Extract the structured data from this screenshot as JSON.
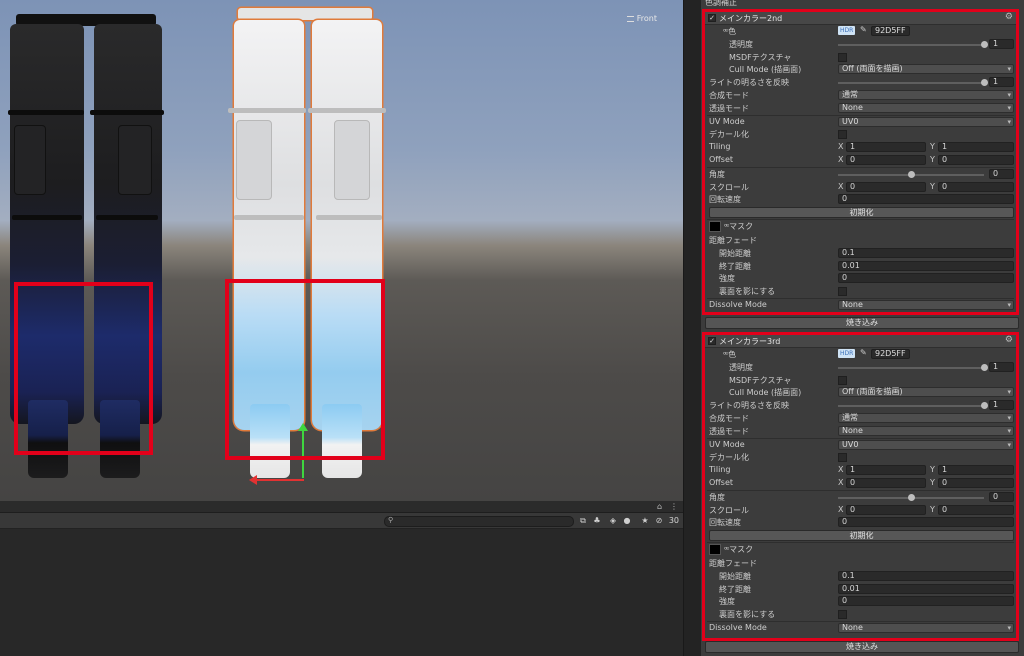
{
  "scene": {
    "view_label": "Front"
  },
  "bottom_panel": {
    "search_placeholder": "",
    "visible_count": "30"
  },
  "inspector": {
    "prev_title": "色調補正",
    "sections": [
      {
        "title": "メインカラー2nd",
        "color_label": "色",
        "hdr": "HDR",
        "hex": "92D5FF",
        "opacity_label": "透明度",
        "opacity_value": "1",
        "opacity_fraction": 1.0,
        "msdf_label": "MSDFテクスチャ",
        "cull_label": "Cull Mode (描画面)",
        "cull_value": "Off (両面を描画)",
        "light_label": "ライトの明るさを反映",
        "light_value": "1",
        "light_fraction": 1.0,
        "blend_label": "合成モード",
        "blend_value": "通常",
        "alpha_label": "透過モード",
        "alpha_value": "None",
        "uv_label": "UV Mode",
        "uv_value": "UV0",
        "decal_label": "デカール化",
        "tiling_label": "Tiling",
        "tiling_x": "1",
        "tiling_y": "1",
        "offset_label": "Offset",
        "offset_x": "0",
        "offset_y": "0",
        "angle_label": "角度",
        "angle_value": "0",
        "angle_fraction": 0.5,
        "scroll_label": "スクロール",
        "scroll_x": "0",
        "scroll_y": "0",
        "rotate_label": "回転速度",
        "rotate_value": "0",
        "reset_label": "初期化",
        "mask_label": "マスク",
        "distfade_label": "距離フェード",
        "start_label": "開始距離",
        "start_value": "0.1",
        "end_label": "終了距離",
        "end_value": "0.01",
        "strength_label": "強度",
        "strength_value": "0",
        "backface_label": "裏面を影にする",
        "dissolve_label": "Dissolve Mode",
        "dissolve_value": "None",
        "bake_label": "焼き込み"
      },
      {
        "title": "メインカラー3rd",
        "color_label": "色",
        "hdr": "HDR",
        "hex": "92D5FF",
        "opacity_label": "透明度",
        "opacity_value": "1",
        "opacity_fraction": 1.0,
        "msdf_label": "MSDFテクスチャ",
        "cull_label": "Cull Mode (描画面)",
        "cull_value": "Off (両面を描画)",
        "light_label": "ライトの明るさを反映",
        "light_value": "1",
        "light_fraction": 1.0,
        "blend_label": "合成モード",
        "blend_value": "通常",
        "alpha_label": "透過モード",
        "alpha_value": "None",
        "uv_label": "UV Mode",
        "uv_value": "UV0",
        "decal_label": "デカール化",
        "tiling_label": "Tiling",
        "tiling_x": "1",
        "tiling_y": "1",
        "offset_label": "Offset",
        "offset_x": "0",
        "offset_y": "0",
        "angle_label": "角度",
        "angle_value": "0",
        "angle_fraction": 0.5,
        "scroll_label": "スクロール",
        "scroll_x": "0",
        "scroll_y": "0",
        "rotate_label": "回転速度",
        "rotate_value": "0",
        "reset_label": "初期化",
        "mask_label": "マスク",
        "distfade_label": "距離フェード",
        "start_label": "開始距離",
        "start_value": "0.1",
        "end_label": "終了距離",
        "end_value": "0.01",
        "strength_label": "強度",
        "strength_value": "0",
        "backface_label": "裏面を影にする",
        "dissolve_label": "Dissolve Mode",
        "dissolve_value": "None",
        "bake_label": "焼き込み"
      }
    ]
  },
  "colors": {
    "highlight": "#e2001a",
    "main_color": "#92D5FF",
    "selection_outline": "#e07a3a"
  }
}
